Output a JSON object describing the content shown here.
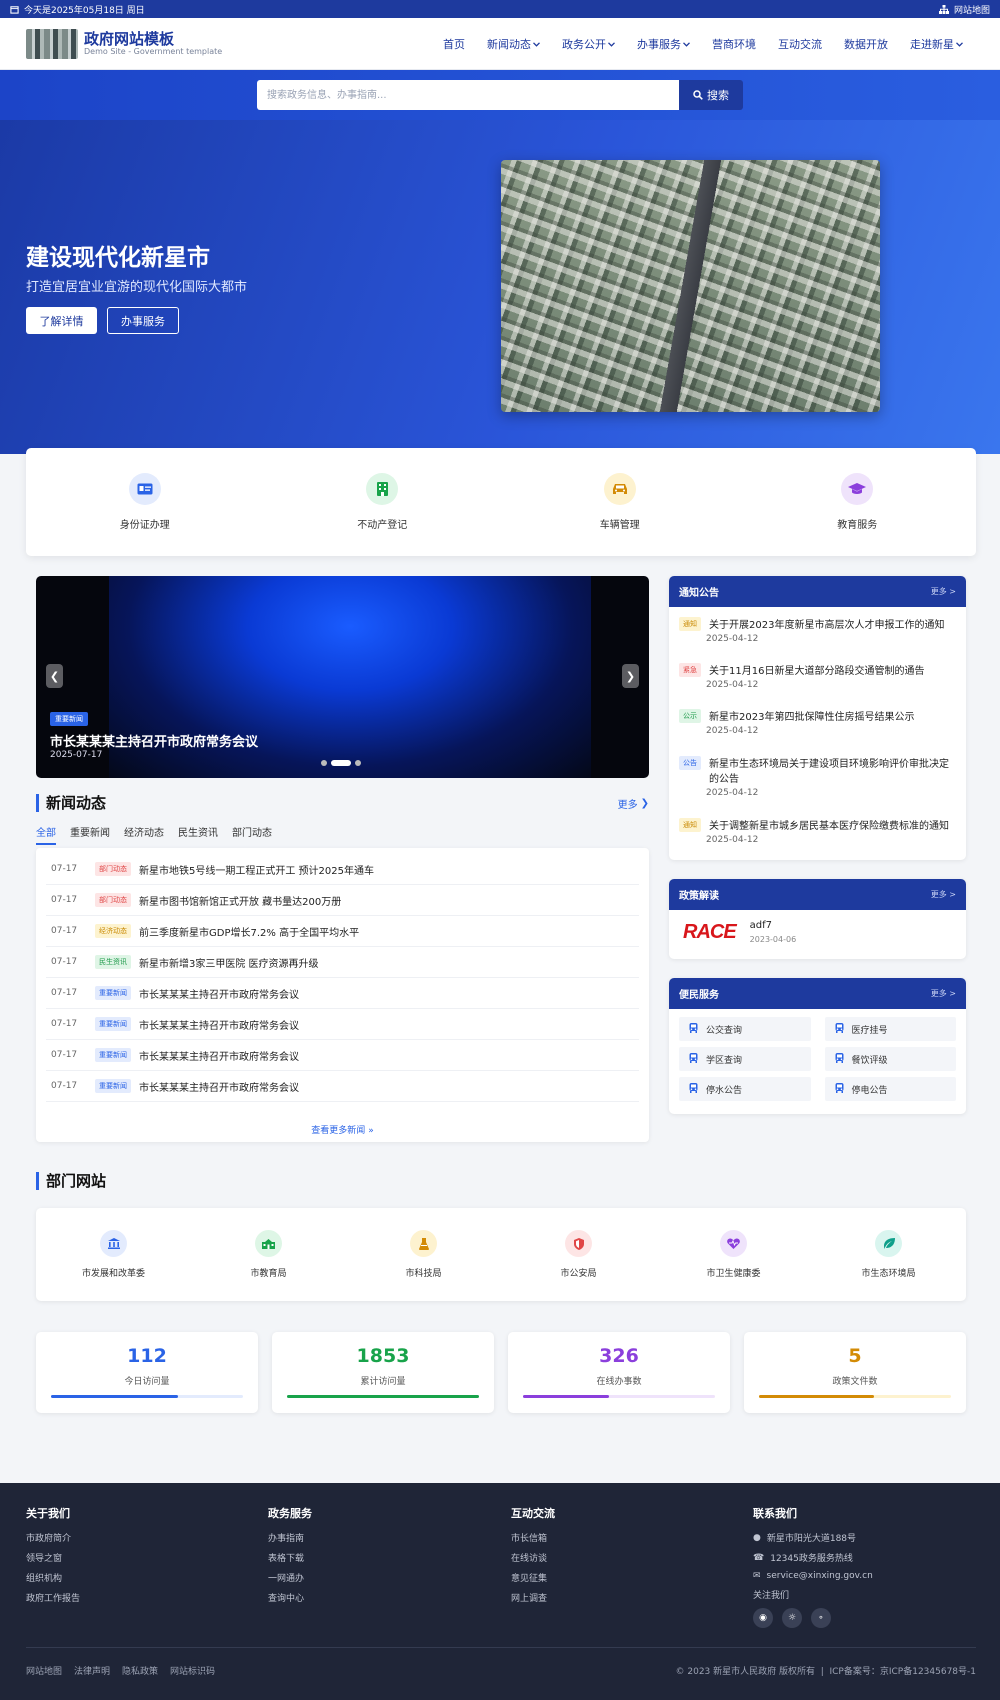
{
  "topbar": {
    "date_text": "今天是2025年05月18日 周日",
    "sitemap": "网站地图"
  },
  "brand": {
    "title": "政府网站模板",
    "subtitle": "Demo Site - Government template"
  },
  "nav": [
    {
      "label": "首页",
      "dropdown": false
    },
    {
      "label": "新闻动态",
      "dropdown": true
    },
    {
      "label": "政务公开",
      "dropdown": true
    },
    {
      "label": "办事服务",
      "dropdown": true
    },
    {
      "label": "营商环境",
      "dropdown": false
    },
    {
      "label": "互动交流",
      "dropdown": false
    },
    {
      "label": "数据开放",
      "dropdown": false
    },
    {
      "label": "走进新星",
      "dropdown": true
    }
  ],
  "search": {
    "placeholder": "搜索政务信息、办事指南...",
    "button": "搜索"
  },
  "hero": {
    "title": "建设现代化新星市",
    "subtitle": "打造宜居宜业宜游的现代化国际大都市",
    "btn_primary": "了解详情",
    "btn_secondary": "办事服务"
  },
  "quick_services": [
    {
      "label": "身份证办理",
      "icon": "id-card-icon",
      "color": "#2a63e6",
      "bg": "#e3ebfd"
    },
    {
      "label": "不动产登记",
      "icon": "building-icon",
      "color": "#18a34a",
      "bg": "#def6e6"
    },
    {
      "label": "车辆管理",
      "icon": "car-icon",
      "color": "#d38b06",
      "bg": "#fdf2cf"
    },
    {
      "label": "教育服务",
      "icon": "graduation-cap-icon",
      "color": "#8b3fdc",
      "bg": "#efe3fb"
    }
  ],
  "slider": {
    "tag": "重要新闻",
    "title": "市长某某某主持召开市政府常务会议",
    "date": "2025-07-17"
  },
  "news": {
    "title": "新闻动态",
    "more": "更多",
    "tabs": [
      "全部",
      "重要新闻",
      "经济动态",
      "民生资讯",
      "部门动态"
    ],
    "items": [
      {
        "date": "07-17",
        "tag": "部门动态",
        "title": "新星市地铁5号线一期工程正式开工 预计2025年通车",
        "tag_color": "#e04646",
        "tag_bg": "#fde5e5"
      },
      {
        "date": "07-17",
        "tag": "部门动态",
        "title": "新星市图书馆新馆正式开放 藏书量达200万册",
        "tag_color": "#e04646",
        "tag_bg": "#fde5e5"
      },
      {
        "date": "07-17",
        "tag": "经济动态",
        "title": "前三季度新星市GDP增长7.2% 高于全国平均水平",
        "tag_color": "#c98a05",
        "tag_bg": "#fdf3cf"
      },
      {
        "date": "07-17",
        "tag": "民生资讯",
        "title": "新星市新增3家三甲医院 医疗资源再升级",
        "tag_color": "#1f9a4b",
        "tag_bg": "#dff5e6"
      },
      {
        "date": "07-17",
        "tag": "重要新闻",
        "title": "市长某某某主持召开市政府常务会议",
        "tag_color": "#2a63e6",
        "tag_bg": "#e3ebfd"
      },
      {
        "date": "07-17",
        "tag": "重要新闻",
        "title": "市长某某某主持召开市政府常务会议",
        "tag_color": "#2a63e6",
        "tag_bg": "#e3ebfd"
      },
      {
        "date": "07-17",
        "tag": "重要新闻",
        "title": "市长某某某主持召开市政府常务会议",
        "tag_color": "#2a63e6",
        "tag_bg": "#e3ebfd"
      },
      {
        "date": "07-17",
        "tag": "重要新闻",
        "title": "市长某某某主持召开市政府常务会议",
        "tag_color": "#2a63e6",
        "tag_bg": "#e3ebfd"
      }
    ],
    "view_more": "查看更多新闻"
  },
  "notices": {
    "title": "通知公告",
    "more": "更多 >",
    "items": [
      {
        "tag": "通知",
        "title": "关于开展2023年度新星市高层次人才申报工作的通知",
        "date": "2025-04-12",
        "tag_color": "#c98a05",
        "tag_bg": "#fdf3cf"
      },
      {
        "tag": "紧急",
        "title": "关于11月16日新星大道部分路段交通管制的通告",
        "date": "2025-04-12",
        "tag_color": "#e04646",
        "tag_bg": "#fde5e5"
      },
      {
        "tag": "公示",
        "title": "新星市2023年第四批保障性住房摇号结果公示",
        "date": "2025-04-12",
        "tag_color": "#1f9a4b",
        "tag_bg": "#dff5e6"
      },
      {
        "tag": "公告",
        "title": "新星市生态环境局关于建设项目环境影响评价审批决定的公告",
        "date": "2025-04-12",
        "tag_color": "#2a63e6",
        "tag_bg": "#e3ebfd"
      },
      {
        "tag": "通知",
        "title": "关于调整新星市城乡居民基本医疗保险缴费标准的通知",
        "date": "2025-04-12",
        "tag_color": "#c98a05",
        "tag_bg": "#fdf3cf"
      }
    ]
  },
  "policy": {
    "title": "政策解读",
    "more": "更多 >",
    "logo_text": "RACE",
    "item_title": "adf7",
    "item_date": "2023-04-06"
  },
  "convenience": {
    "title": "便民服务",
    "more": "更多 >",
    "items": [
      "公交查询",
      "医疗挂号",
      "学区查询",
      "餐饮评级",
      "停水公告",
      "停电公告"
    ]
  },
  "departments": {
    "title": "部门网站",
    "items": [
      {
        "label": "市发展和改革委",
        "icon": "bank-icon",
        "color": "#2a63e6",
        "bg": "#e3ebfd"
      },
      {
        "label": "市教育局",
        "icon": "school-icon",
        "color": "#18a34a",
        "bg": "#def6e6"
      },
      {
        "label": "市科技局",
        "icon": "flask-icon",
        "color": "#d38b06",
        "bg": "#fdf2cf"
      },
      {
        "label": "市公安局",
        "icon": "shield-icon",
        "color": "#e04646",
        "bg": "#fde5e5"
      },
      {
        "label": "市卫生健康委",
        "icon": "heart-pulse-icon",
        "color": "#8b3fdc",
        "bg": "#efe3fb"
      },
      {
        "label": "市生态环境局",
        "icon": "leaf-icon",
        "color": "#0f9f8a",
        "bg": "#d9f5ef"
      }
    ]
  },
  "stats": [
    {
      "value": "112",
      "label": "今日访问量",
      "color": "#2a63e6",
      "track": "#e3ebfd",
      "progress": 0.66
    },
    {
      "value": "1853",
      "label": "累计访问量",
      "color": "#18a34a",
      "track": "#def6e6",
      "progress": 1.0
    },
    {
      "value": "326",
      "label": "在线办事数",
      "color": "#8b3fdc",
      "track": "#efe3fb",
      "progress": 0.45
    },
    {
      "value": "5",
      "label": "政策文件数",
      "color": "#d38b06",
      "track": "#fdf2cf",
      "progress": 0.6
    }
  ],
  "footer": {
    "about": {
      "title": "关于我们",
      "links": [
        "市政府简介",
        "领导之窗",
        "组织机构",
        "政府工作报告"
      ]
    },
    "services": {
      "title": "政务服务",
      "links": [
        "办事指南",
        "表格下载",
        "一网通办",
        "查询中心"
      ]
    },
    "interact": {
      "title": "互动交流",
      "links": [
        "市长信箱",
        "在线访谈",
        "意见征集",
        "网上调查"
      ]
    },
    "contact": {
      "title": "联系我们",
      "address": "新星市阳光大道188号",
      "phone": "12345政务服务热线",
      "email": "service@xinxing.gov.cn",
      "follow": "关注我们"
    },
    "bottom_links": [
      "网站地图",
      "法律声明",
      "隐私政策",
      "网站标识码"
    ],
    "copyright": "© 2023 新星市人民政府 版权所有",
    "icp": "ICP备案号：京ICP备12345678号-1"
  }
}
